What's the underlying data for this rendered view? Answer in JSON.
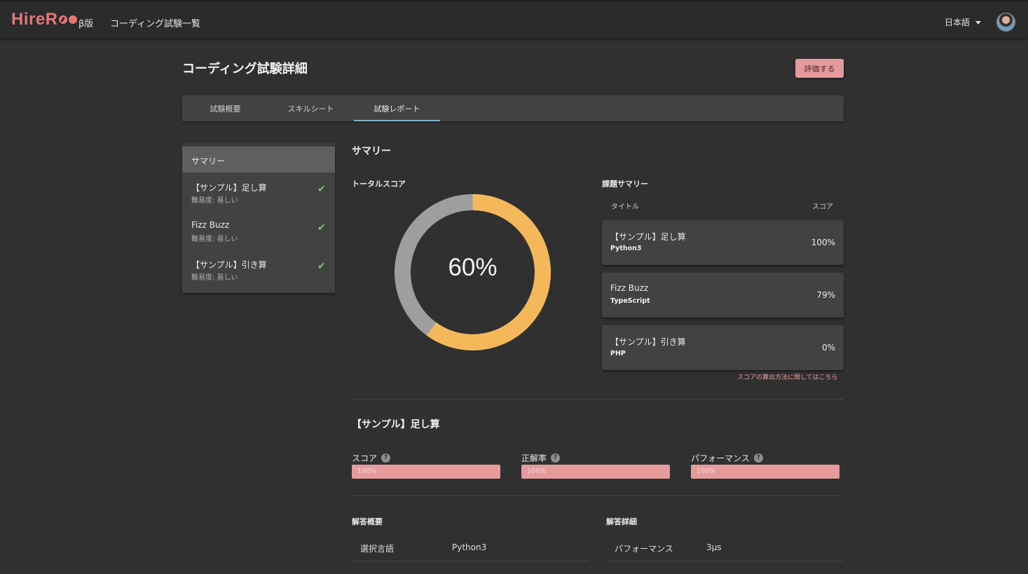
{
  "app": {
    "logo_text": "HireR",
    "logo_icon": "double-circle-logo",
    "beta_label": "β版",
    "nav_link": "コーディング試験一覧"
  },
  "header": {
    "language": "日本語",
    "avatar_icon": "user-avatar"
  },
  "page": {
    "title": "コーディング試験詳細",
    "evaluate_button": "評価する"
  },
  "tabs": [
    {
      "label": "試験概要",
      "active": false
    },
    {
      "label": "スキルシート",
      "active": false
    },
    {
      "label": "試験レポート",
      "active": true
    }
  ],
  "sidebar": {
    "header": "サマリー",
    "items": [
      {
        "name": "【サンプル】足し算",
        "difficulty": "難易度: 易しい",
        "check_icon": "check-icon"
      },
      {
        "name": "Fizz Buzz",
        "difficulty": "難易度: 易しい",
        "check_icon": "check-icon"
      },
      {
        "name": "【サンプル】引き算",
        "difficulty": "難易度: 易しい",
        "check_icon": "check-icon"
      }
    ]
  },
  "summary": {
    "title": "サマリー",
    "total_score_label": "トータルスコア",
    "total_score": "60%",
    "total_score_fraction": 0.6,
    "colors": {
      "filled": "#f4b85a",
      "remaining": "#9e9e9e"
    },
    "task_summary_label": "課題サマリー",
    "columns": {
      "title": "タイトル",
      "score": "スコア"
    },
    "tasks": [
      {
        "name": "【サンプル】足し算",
        "language": "Python3",
        "score": "100%"
      },
      {
        "name": "Fizz Buzz",
        "language": "TypeScript",
        "score": "79%"
      },
      {
        "name": "【サンプル】引き算",
        "language": "PHP",
        "score": "0%"
      }
    ],
    "score_method_link": "スコアの算出方法に関してはこちら"
  },
  "detail": {
    "title": "【サンプル】足し算",
    "metrics": [
      {
        "label": "スコア",
        "value": "100%",
        "fraction": 1.0
      },
      {
        "label": "正解率",
        "value": "100%",
        "fraction": 1.0
      },
      {
        "label": "パフォーマンス",
        "value": "100%",
        "fraction": 1.0
      }
    ],
    "help_icon": "?",
    "answer_overview_label": "解答概要",
    "answer_detail_label": "解答詳細",
    "overview_rows": [
      {
        "key": "選択言語",
        "value": "Python3"
      }
    ],
    "detail_rows": [
      {
        "key": "パフォーマンス",
        "value": "3μs"
      }
    ]
  }
}
